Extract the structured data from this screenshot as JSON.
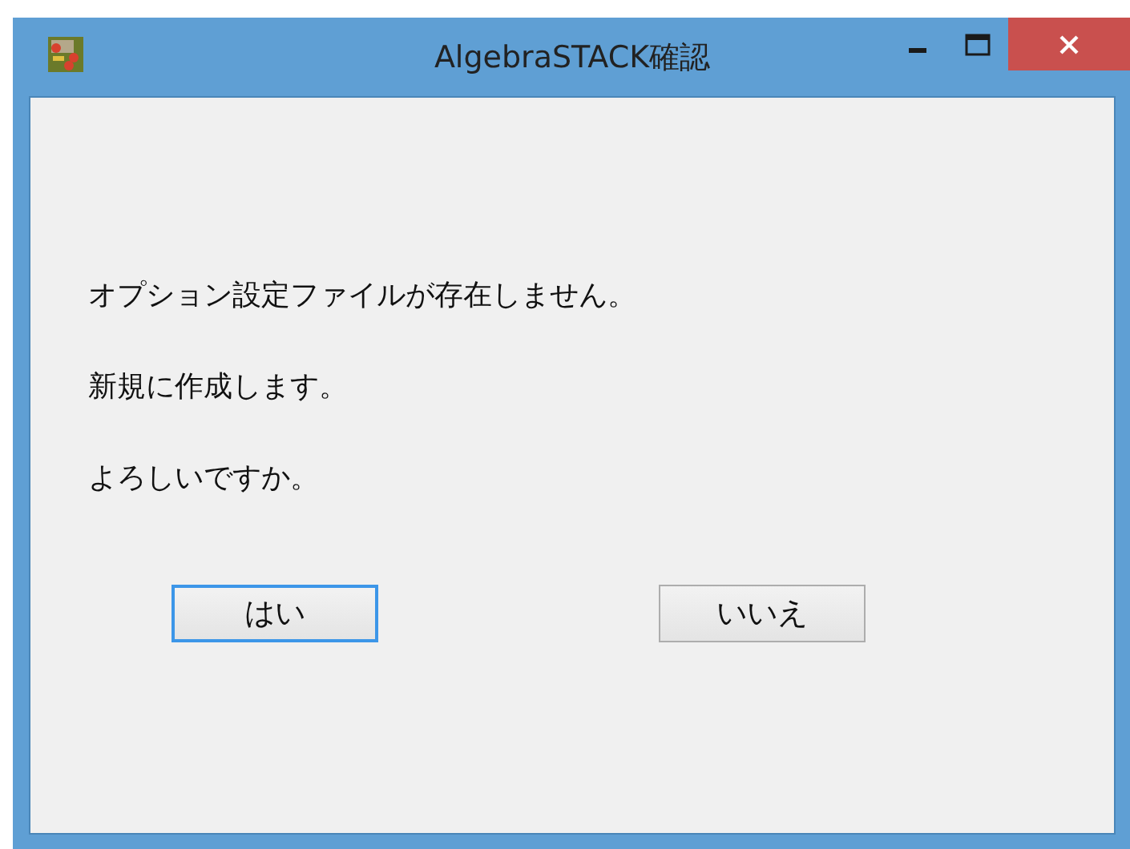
{
  "window": {
    "title": "AlgebraSTACK確認"
  },
  "message": [
    "オプション設定ファイルが存在しません。",
    "新規に作成します。",
    "よろしいですか。"
  ],
  "buttons": [
    {
      "label": "はい",
      "default": true
    },
    {
      "label": "いいえ",
      "default": false
    }
  ]
}
